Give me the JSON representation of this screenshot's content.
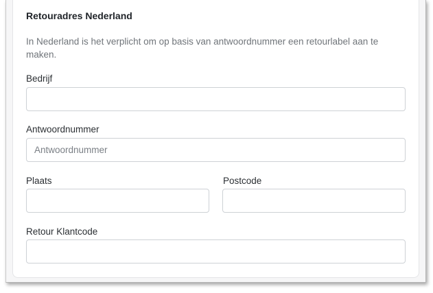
{
  "section": {
    "title": "Retouradres Nederland",
    "description": "In Nederland is het verplicht om op basis van antwoordnummer een retourlabel aan te maken."
  },
  "fields": {
    "bedrijf": {
      "label": "Bedrijf",
      "value": "",
      "placeholder": ""
    },
    "antwoordnummer": {
      "label": "Antwoordnummer",
      "value": "",
      "placeholder": "Antwoordnummer"
    },
    "plaats": {
      "label": "Plaats",
      "value": "",
      "placeholder": ""
    },
    "postcode": {
      "label": "Postcode",
      "value": "",
      "placeholder": ""
    },
    "retour_klantcode": {
      "label": "Retour Klantcode",
      "value": "",
      "placeholder": ""
    }
  }
}
